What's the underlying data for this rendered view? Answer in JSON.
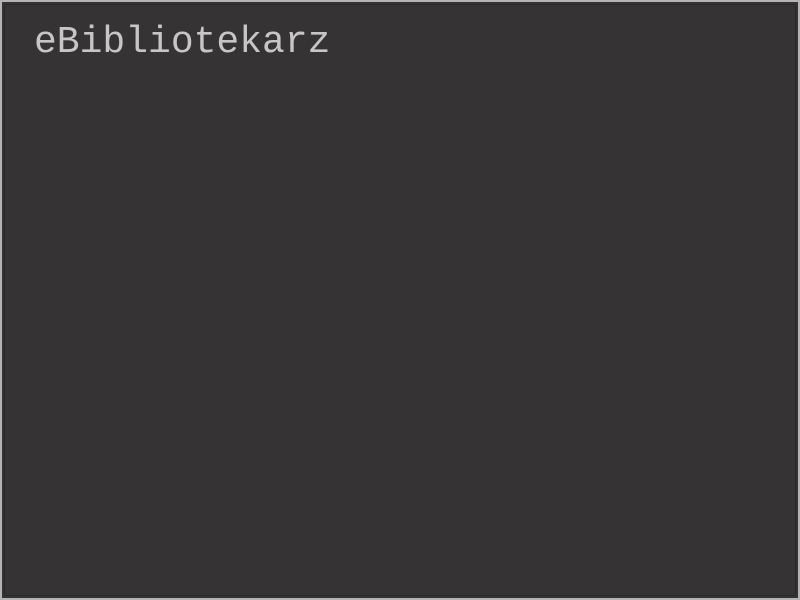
{
  "app": {
    "title": "eBibliotekarz"
  },
  "colors": {
    "background": "#353334",
    "border": "#b4b4b4",
    "title_text": "#c6c6c6"
  }
}
